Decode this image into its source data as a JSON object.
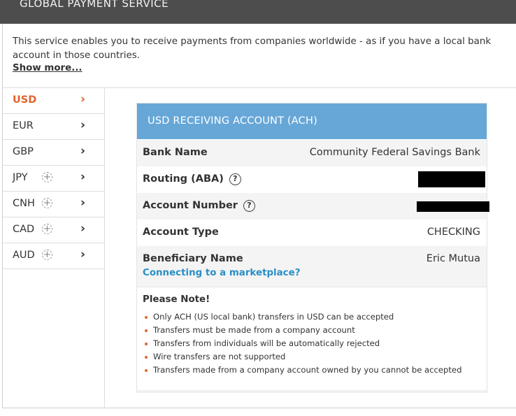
{
  "header": {
    "title": "GLOBAL PAYMENT SERVICE"
  },
  "intro": {
    "text": "This service enables you to receive payments from companies worldwide - as if you have a local bank account in those countries.",
    "show_more": "Show more..."
  },
  "currencies": [
    {
      "code": "USD",
      "active": true,
      "has_plus": false
    },
    {
      "code": "EUR",
      "active": false,
      "has_plus": false
    },
    {
      "code": "GBP",
      "active": false,
      "has_plus": false
    },
    {
      "code": "JPY",
      "active": false,
      "has_plus": true
    },
    {
      "code": "CNH",
      "active": false,
      "has_plus": true
    },
    {
      "code": "CAD",
      "active": false,
      "has_plus": true
    },
    {
      "code": "AUD",
      "active": false,
      "has_plus": true
    }
  ],
  "icons": {
    "chevron": "chevron-right-icon",
    "plus": "plus-circle-icon",
    "help": "question-circle-icon"
  },
  "colors": {
    "accent": "#e0632a",
    "card_header": "#67a7d8",
    "link": "#2a8ec6"
  },
  "account": {
    "title": "USD RECEIVING ACCOUNT (ACH)",
    "bank_name_label": "Bank Name",
    "bank_name_value": "Community Federal Savings Bank",
    "routing_label": "Routing (ABA)",
    "account_number_label": "Account Number",
    "account_type_label": "Account Type",
    "account_type_value": "CHECKING",
    "beneficiary_label": "Beneficiary Name",
    "beneficiary_value": "Eric Mutua",
    "marketplace_link": "Connecting to a marketplace?",
    "help_glyph": "?"
  },
  "note": {
    "title": "Please Note!",
    "items": [
      "Only ACH (US local bank) transfers in USD can be accepted",
      "Transfers must be made from a company account",
      "Transfers from individuals will be automatically rejected",
      "Wire transfers are not supported",
      "Transfers made from a company account owned by you cannot be accepted"
    ]
  }
}
